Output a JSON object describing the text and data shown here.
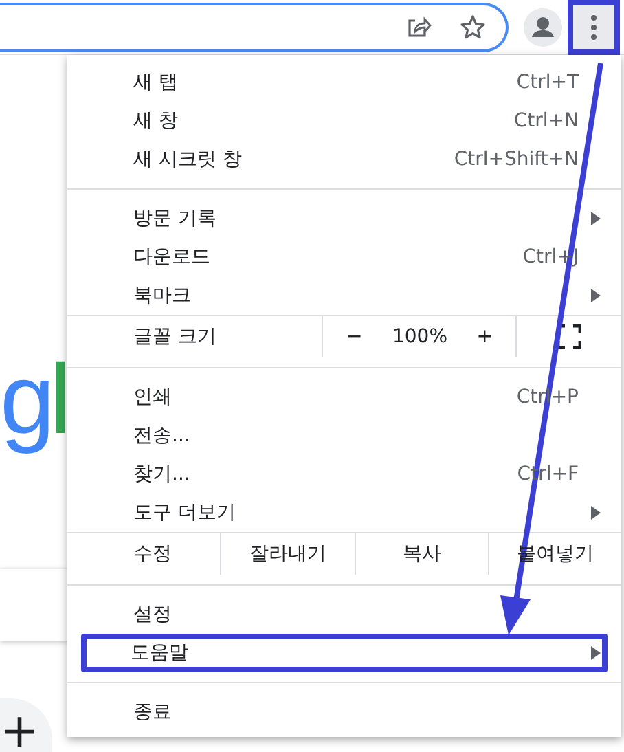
{
  "toolbar": {
    "menu_button_highlighted": true
  },
  "logo": [
    {
      "text": "g",
      "color": "#4285f4"
    },
    {
      "text": "l",
      "color": "#34a853"
    }
  ],
  "shortcut_tile": {
    "symbol": "+"
  },
  "menu": {
    "sections": [
      {
        "items": [
          {
            "kind": "item",
            "label": "새 탭",
            "shortcut": "Ctrl+T",
            "submenu": false,
            "highlighted": false
          },
          {
            "kind": "item",
            "label": "새 창",
            "shortcut": "Ctrl+N",
            "submenu": false,
            "highlighted": false
          },
          {
            "kind": "item",
            "label": "새 시크릿 창",
            "shortcut": "Ctrl+Shift+N",
            "submenu": false,
            "highlighted": false
          }
        ]
      },
      {
        "items": [
          {
            "kind": "item",
            "label": "방문 기록",
            "submenu": true,
            "highlighted": false
          },
          {
            "kind": "item",
            "label": "다운로드",
            "shortcut": "Ctrl+J",
            "submenu": false,
            "highlighted": false
          },
          {
            "kind": "item",
            "label": "북마크",
            "submenu": true,
            "highlighted": false
          }
        ]
      },
      {
        "items": [
          {
            "kind": "zoom",
            "label": "글꼴 크기",
            "minus": "−",
            "value": "100%",
            "plus": "+"
          }
        ]
      },
      {
        "items": [
          {
            "kind": "item",
            "label": "인쇄",
            "shortcut": "Ctrl+P",
            "submenu": false,
            "highlighted": false
          },
          {
            "kind": "item",
            "label": "전송...",
            "submenu": false,
            "highlighted": false
          },
          {
            "kind": "item",
            "label": "찾기...",
            "shortcut": "Ctrl+F",
            "submenu": false,
            "highlighted": false
          },
          {
            "kind": "item",
            "label": "도구 더보기",
            "submenu": true,
            "highlighted": false
          }
        ]
      },
      {
        "items": [
          {
            "kind": "edit",
            "label": "수정",
            "buttons": [
              "잘라내기",
              "복사",
              "붙여넣기"
            ]
          }
        ]
      },
      {
        "items": [
          {
            "kind": "item",
            "label": "설정",
            "submenu": false,
            "highlighted": false
          },
          {
            "kind": "item",
            "label": "도움말",
            "submenu": true,
            "highlighted": true
          }
        ]
      },
      {
        "items": [
          {
            "kind": "item",
            "label": "종료",
            "submenu": false,
            "highlighted": false
          }
        ]
      }
    ]
  },
  "annotation": {
    "arrow": true
  }
}
